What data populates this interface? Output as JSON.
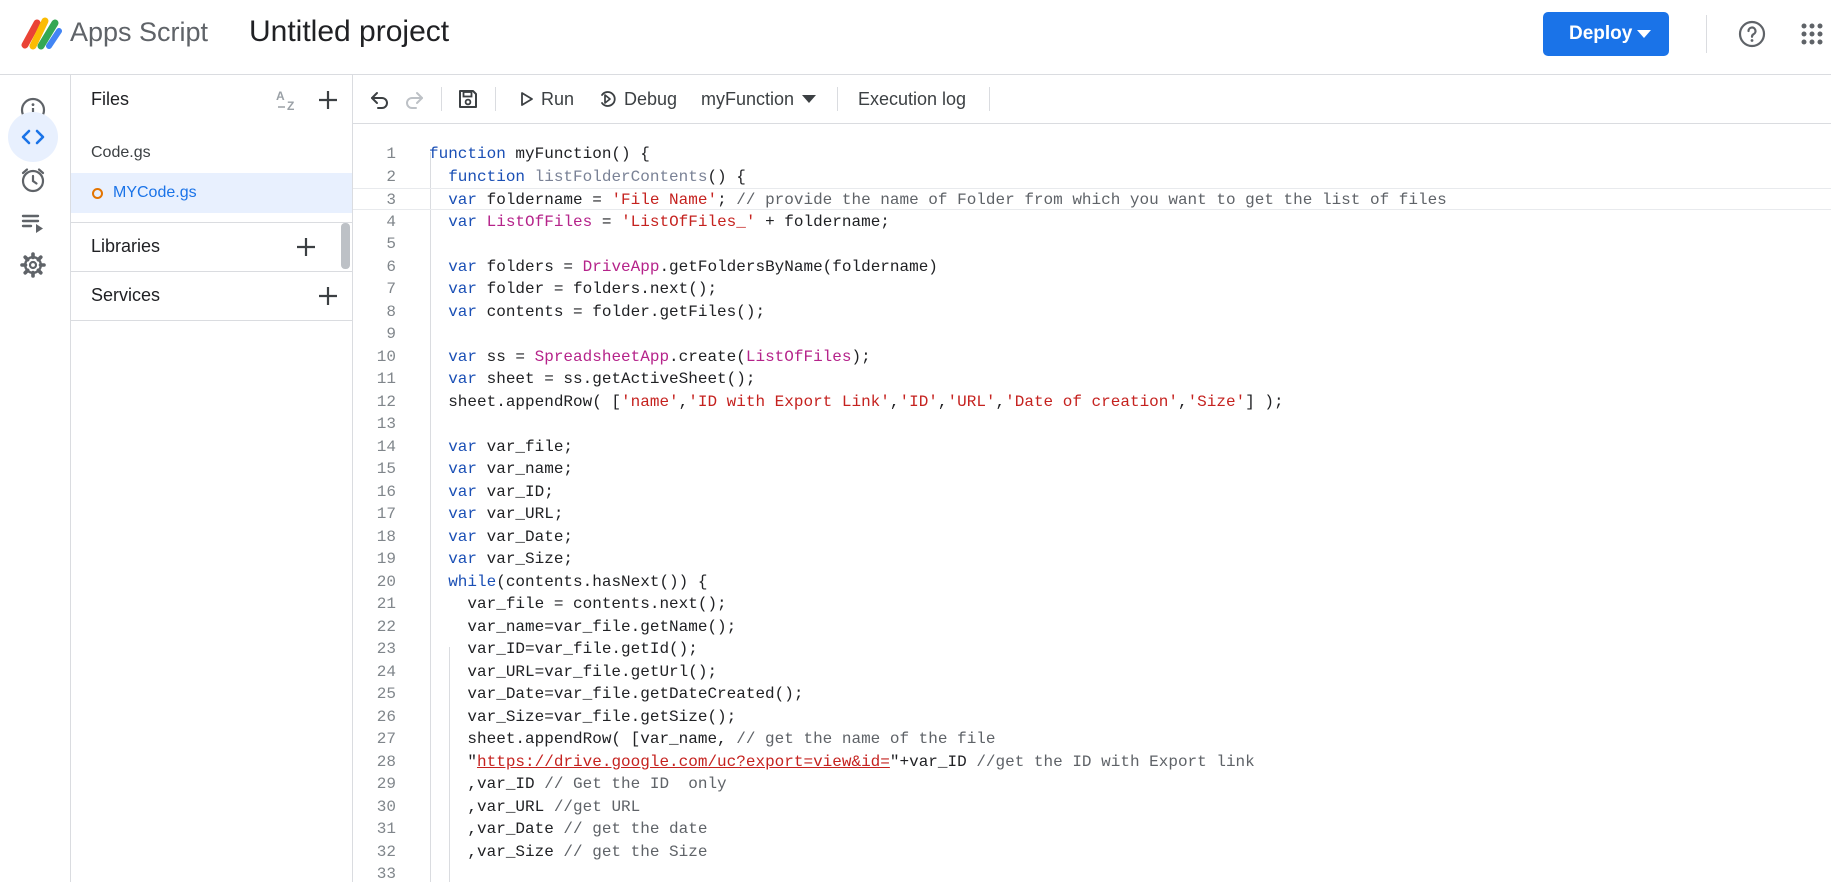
{
  "header": {
    "app_name": "Apps Script",
    "project_title": "Untitled project",
    "deploy_label": "Deploy"
  },
  "rail": {
    "items": [
      {
        "icon": "info-icon",
        "name": "Overview"
      },
      {
        "icon": "code-icon",
        "name": "Editor",
        "active": true
      },
      {
        "icon": "clock-icon",
        "name": "Triggers"
      },
      {
        "icon": "executions-icon",
        "name": "Executions"
      },
      {
        "icon": "gear-icon",
        "name": "Project Settings"
      }
    ]
  },
  "files_panel": {
    "title": "Files",
    "files": [
      {
        "name": "Code.gs",
        "selected": false
      },
      {
        "name": "MYCode.gs",
        "selected": true,
        "unsaved": true
      }
    ],
    "libraries_label": "Libraries",
    "services_label": "Services"
  },
  "toolbar": {
    "run_label": "Run",
    "debug_label": "Debug",
    "function_name": "myFunction",
    "execution_log_label": "Execution log"
  },
  "colors": {
    "accent": "#1a73e8",
    "keyword": "#1a4fb5",
    "string": "#c5221f",
    "class": "#b5238a",
    "unsaved_dot": "#e37400"
  },
  "editor": {
    "current_line": 3,
    "lines": [
      {
        "n": "1",
        "t": "function myFunction() {"
      },
      {
        "n": "2",
        "t": "  function listFolderContents() {"
      },
      {
        "n": "3",
        "t": "  var foldername = 'File Name'; // provide the name of Folder from which you want to get the list of files"
      },
      {
        "n": "4",
        "t": "  var ListOfFiles = 'ListOfFiles_' + foldername;"
      },
      {
        "n": "5",
        "t": ""
      },
      {
        "n": "6",
        "t": "  var folders = DriveApp.getFoldersByName(foldername)"
      },
      {
        "n": "7",
        "t": "  var folder = folders.next();"
      },
      {
        "n": "8",
        "t": "  var contents = folder.getFiles();"
      },
      {
        "n": "9",
        "t": ""
      },
      {
        "n": "10",
        "t": "  var ss = SpreadsheetApp.create(ListOfFiles);"
      },
      {
        "n": "11",
        "t": "  var sheet = ss.getActiveSheet();"
      },
      {
        "n": "12",
        "t": "  sheet.appendRow( ['name','ID with Export Link','ID','URL','Date of creation','Size'] );"
      },
      {
        "n": "13",
        "t": ""
      },
      {
        "n": "14",
        "t": "  var var_file;"
      },
      {
        "n": "15",
        "t": "  var var_name;"
      },
      {
        "n": "16",
        "t": "  var var_ID;"
      },
      {
        "n": "17",
        "t": "  var var_URL;"
      },
      {
        "n": "18",
        "t": "  var var_Date;"
      },
      {
        "n": "19",
        "t": "  var var_Size;"
      },
      {
        "n": "20",
        "t": "  while(contents.hasNext()) {"
      },
      {
        "n": "21",
        "t": "    var_file = contents.next();"
      },
      {
        "n": "22",
        "t": "    var_name=var_file.getName();"
      },
      {
        "n": "23",
        "t": "    var_ID=var_file.getId();"
      },
      {
        "n": "24",
        "t": "    var_URL=var_file.getUrl();"
      },
      {
        "n": "25",
        "t": "    var_Date=var_file.getDateCreated();"
      },
      {
        "n": "26",
        "t": "    var_Size=var_file.getSize();"
      },
      {
        "n": "27",
        "t": "    sheet.appendRow( [var_name, // get the name of the file"
      },
      {
        "n": "28",
        "t": "    \"https://drive.google.com/uc?export=view&id=\"+var_ID //get the ID with Export link"
      },
      {
        "n": "29",
        "t": "    ,var_ID // Get the ID  only"
      },
      {
        "n": "30",
        "t": "    ,var_URL //get URL"
      },
      {
        "n": "31",
        "t": "    ,var_Date // get the date"
      },
      {
        "n": "32",
        "t": "    ,var_Size // get the Size"
      },
      {
        "n": "33",
        "t": ""
      }
    ]
  }
}
